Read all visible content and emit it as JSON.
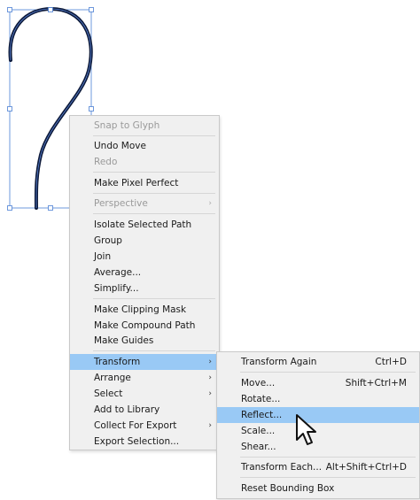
{
  "colors": {
    "menu_bg": "#f0f0f0",
    "highlight": "#99c9f5",
    "selection": "#4a7fd4",
    "path_stroke": "#0d1a3a"
  },
  "context_menu": {
    "snap_to_glyph": "Snap to Glyph",
    "undo_move": "Undo Move",
    "redo": "Redo",
    "make_pixel_perfect": "Make Pixel Perfect",
    "perspective": "Perspective",
    "isolate_selected_path": "Isolate Selected Path",
    "group": "Group",
    "join": "Join",
    "average": "Average...",
    "simplify": "Simplify...",
    "make_clipping_mask": "Make Clipping Mask",
    "make_compound_path": "Make Compound Path",
    "make_guides": "Make Guides",
    "transform": "Transform",
    "arrange": "Arrange",
    "select": "Select",
    "add_to_library": "Add to Library",
    "collect_for_export": "Collect For Export",
    "export_selection": "Export Selection...",
    "submenu_arrow": "›"
  },
  "transform_submenu": {
    "transform_again": "Transform Again",
    "transform_again_shortcut": "Ctrl+D",
    "move": "Move...",
    "move_shortcut": "Shift+Ctrl+M",
    "rotate": "Rotate...",
    "reflect": "Reflect...",
    "scale": "Scale...",
    "shear": "Shear...",
    "transform_each": "Transform Each...",
    "transform_each_shortcut": "Alt+Shift+Ctrl+D",
    "reset_bounding_box": "Reset Bounding Box"
  }
}
